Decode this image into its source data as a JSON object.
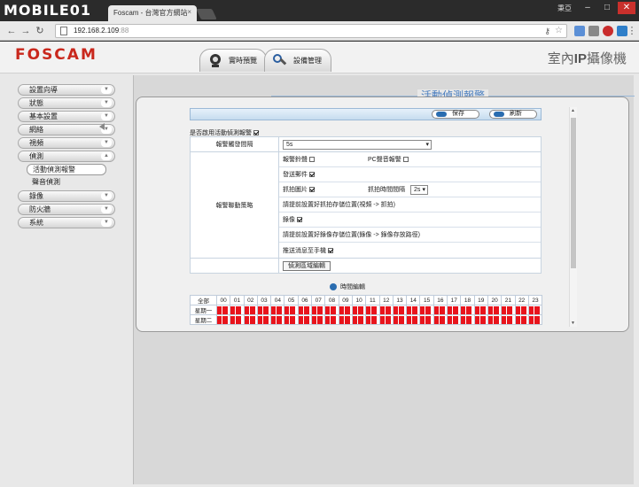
{
  "browser": {
    "logo_text": "MOBILE01",
    "tab_title": "Foscam - 台灣官方網站",
    "tab_close": "×",
    "user_label": "秉亞",
    "url_host": "192.168.2.109",
    "url_port": ":88",
    "win_min": "–",
    "win_max": "□",
    "win_close": "✕"
  },
  "header": {
    "brand": "FOSCAM",
    "tabs": [
      {
        "label": "實時預覽",
        "icon": "camera-icon"
      },
      {
        "label": "設備管理",
        "icon": "settings-icon"
      }
    ],
    "product_pre": "室內",
    "product_bold": "IP",
    "product_post": "攝像機"
  },
  "sidebar": {
    "items": [
      {
        "label": "設置向導"
      },
      {
        "label": "狀態"
      },
      {
        "label": "基本設置"
      },
      {
        "label": "網絡"
      },
      {
        "label": "視頻"
      },
      {
        "label": "偵測"
      }
    ],
    "sub_items": [
      {
        "label": "活動偵測報警",
        "active": true
      },
      {
        "label": "聲音偵測",
        "active": false
      }
    ],
    "items_after": [
      {
        "label": "錄像"
      },
      {
        "label": "防火牆"
      },
      {
        "label": "系統"
      }
    ]
  },
  "panel": {
    "title": "活動偵測報警",
    "save_label": "保存",
    "refresh_label": "刷新",
    "enable_label": "是否啟用活動偵測報警",
    "enable_checked": true,
    "interval_label": "報警觸發間隔",
    "interval_value": "5s",
    "linkage_label": "報警聯動策略",
    "alarm_sound": "報警鈴聲",
    "pc_alarm_sound": "PC聲音報警",
    "send_email": "發送郵件",
    "snapshot": "抓拍圖片",
    "snapshot_interval_label": "抓拍時間間隔",
    "snapshot_interval_value": "2s",
    "snapshot_note": "請提前設置好抓拍存儲位置(視頻 -> 抓拍)",
    "record": "錄像",
    "record_note": "請提前設置好錄像存儲位置(錄像 -> 錄像存放路徑)",
    "push": "推送消息至手機",
    "detect_area_btn": "偵測區域編輯",
    "schedule_label": "時間編輯",
    "all_label": "全部",
    "hours": [
      "00",
      "01",
      "02",
      "03",
      "04",
      "05",
      "06",
      "07",
      "08",
      "09",
      "10",
      "11",
      "12",
      "13",
      "14",
      "15",
      "16",
      "17",
      "18",
      "19",
      "20",
      "21",
      "22",
      "23"
    ],
    "days": [
      "星期一",
      "星期二"
    ],
    "scroll_up": "▲",
    "scroll_down": "▼",
    "schedule_color": "#e8141c"
  }
}
